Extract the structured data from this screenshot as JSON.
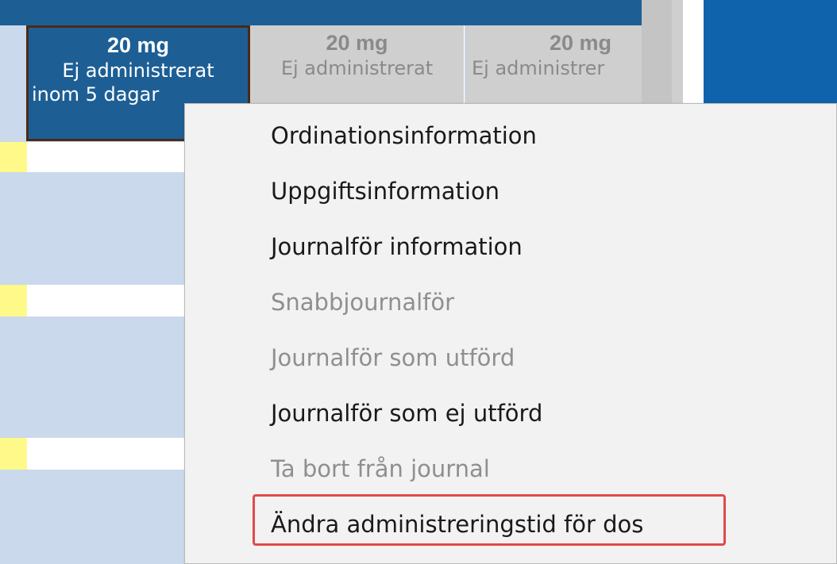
{
  "columns": [
    {
      "dose": "20 mg",
      "status_line1": "Ej administrerat",
      "status_line2": "inom 5 dagar",
      "selected": true
    },
    {
      "dose": "20 mg",
      "status_line1": "Ej administrerat",
      "selected": false
    },
    {
      "dose": "20 mg",
      "status_line1": "Ej administrer",
      "selected": false
    }
  ],
  "context_menu": {
    "items": [
      {
        "label": "Ordinationsinformation",
        "enabled": true
      },
      {
        "label": "Uppgiftsinformation",
        "enabled": true
      },
      {
        "label": "Journalför information",
        "enabled": true
      },
      {
        "label": "Snabbjournalför",
        "enabled": false
      },
      {
        "label": "Journalför som utförd",
        "enabled": false
      },
      {
        "label": "Journalför som ej utförd",
        "enabled": true
      },
      {
        "label": "Ta bort från journal",
        "enabled": false
      },
      {
        "label": "Ändra administreringstid för dos",
        "enabled": true,
        "highlighted": true
      }
    ]
  },
  "colors": {
    "header_blue": "#1d5f95",
    "row_blue": "#cad9eb",
    "marker_yellow": "#fff98a",
    "highlight_red": "#e04a4a"
  }
}
